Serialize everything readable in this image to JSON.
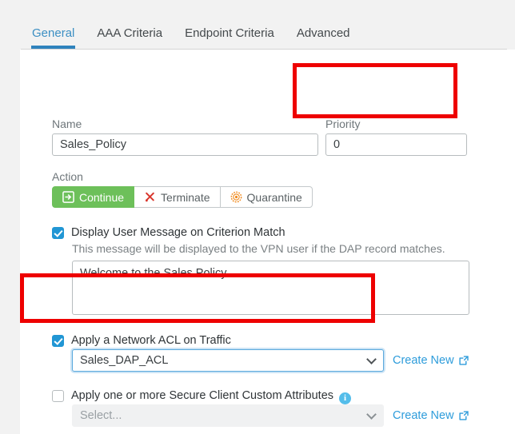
{
  "tabs": [
    {
      "label": "General",
      "active": true
    },
    {
      "label": "AAA Criteria",
      "active": false
    },
    {
      "label": "Endpoint Criteria",
      "active": false
    },
    {
      "label": "Advanced",
      "active": false
    }
  ],
  "form": {
    "name": {
      "label": "Name",
      "value": "Sales_Policy",
      "placeholder": ""
    },
    "priority": {
      "label": "Priority",
      "value": "0",
      "placeholder": ""
    },
    "action": {
      "label": "Action",
      "selected": "Continue",
      "options": [
        {
          "label": "Continue",
          "icon": "continue-arrow-icon",
          "selected": true
        },
        {
          "label": "Terminate",
          "icon": "terminate-x-icon",
          "selected": false
        },
        {
          "label": "Quarantine",
          "icon": "quarantine-biohazard-icon",
          "selected": false
        }
      ]
    },
    "user_message": {
      "checkbox_label": "Display User Message on Criterion Match",
      "checked": true,
      "help": "This message will be displayed to the VPN user if the DAP record matches.",
      "value": "Welcome to the Sales Policy.",
      "placeholder": ""
    },
    "network_acl": {
      "checkbox_label": "Apply a Network ACL on Traffic",
      "checked": true,
      "selected": "Sales_DAP_ACL",
      "create_new": "Create New",
      "disabled": false
    },
    "custom_attributes": {
      "checkbox_label": "Apply one or more Secure Client Custom Attributes",
      "checked": false,
      "info_glyph": "i",
      "selected": "Select...",
      "create_new": "Create New",
      "disabled": true
    }
  },
  "colors": {
    "accent_blue": "#2d9cdb",
    "tab_active": "#2f83bd",
    "continue_green": "#6dc05a",
    "terminate_red": "#d9352c",
    "quarantine_orange": "#f08a1e",
    "checkbox_blue": "#2196d4",
    "highlight_red": "#ee0000",
    "info_blue": "#54bdea"
  }
}
